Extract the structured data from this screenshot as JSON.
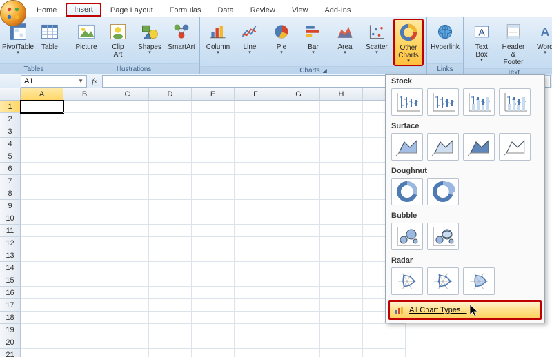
{
  "tabs": [
    "Home",
    "Insert",
    "Page Layout",
    "Formulas",
    "Data",
    "Review",
    "View",
    "Add-Ins"
  ],
  "active_tab": "Insert",
  "groups": {
    "tables": {
      "label": "Tables",
      "items": [
        {
          "label": "PivotTable",
          "icon": "pivot"
        },
        {
          "label": "Table",
          "icon": "table"
        }
      ]
    },
    "illustrations": {
      "label": "Illustrations",
      "items": [
        {
          "label": "Picture",
          "icon": "picture"
        },
        {
          "label": "Clip\nArt",
          "icon": "clipart"
        },
        {
          "label": "Shapes",
          "icon": "shapes"
        },
        {
          "label": "SmartArt",
          "icon": "smartart"
        }
      ]
    },
    "charts": {
      "label": "Charts",
      "items": [
        {
          "label": "Column",
          "icon": "column"
        },
        {
          "label": "Line",
          "icon": "line"
        },
        {
          "label": "Pie",
          "icon": "pie"
        },
        {
          "label": "Bar",
          "icon": "bar"
        },
        {
          "label": "Area",
          "icon": "area"
        },
        {
          "label": "Scatter",
          "icon": "scatter"
        },
        {
          "label": "Other\nCharts",
          "icon": "other"
        }
      ]
    },
    "links": {
      "label": "Links",
      "items": [
        {
          "label": "Hyperlink",
          "icon": "hyperlink"
        }
      ]
    },
    "text": {
      "label": "Text",
      "items": [
        {
          "label": "Text\nBox",
          "icon": "textbox"
        },
        {
          "label": "Header\n& Footer",
          "icon": "headerfooter"
        },
        {
          "label": "Word",
          "icon": "wordart"
        }
      ]
    }
  },
  "namebox_value": "A1",
  "columns": [
    "A",
    "B",
    "C",
    "D",
    "E",
    "F",
    "G",
    "H",
    "I"
  ],
  "row_count": 21,
  "active_cell": {
    "row": 1,
    "col": "A"
  },
  "dropdown": {
    "sections": [
      {
        "label": "Stock",
        "count": 4
      },
      {
        "label": "Surface",
        "count": 4
      },
      {
        "label": "Doughnut",
        "count": 2
      },
      {
        "label": "Bubble",
        "count": 2
      },
      {
        "label": "Radar",
        "count": 3
      }
    ],
    "footer_label": "All Chart Types..."
  },
  "highlights": {
    "tab": "Insert",
    "ribbon_button": "Other\nCharts",
    "dropdown_footer": true
  }
}
